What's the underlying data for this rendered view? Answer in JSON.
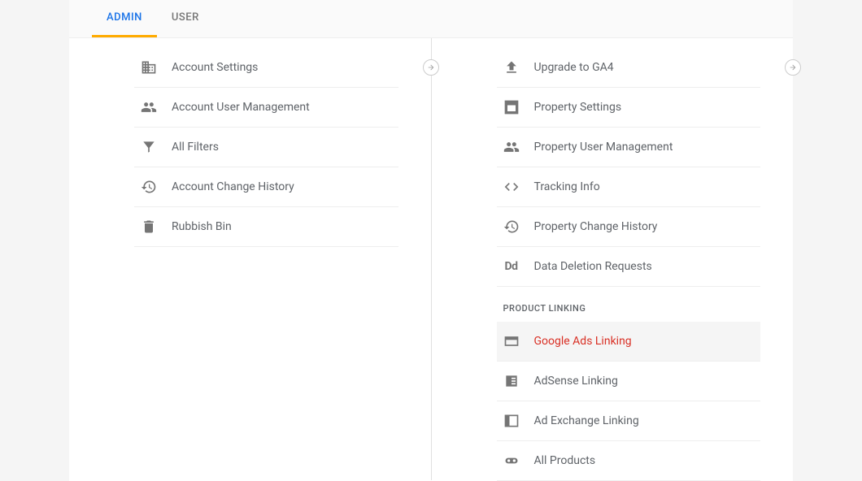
{
  "tabs": {
    "admin": "ADMIN",
    "user": "USER"
  },
  "account": {
    "settings": "Account Settings",
    "userMgmt": "Account User Management",
    "filters": "All Filters",
    "history": "Account Change History",
    "rubbish": "Rubbish Bin"
  },
  "property": {
    "upgrade": "Upgrade to GA4",
    "settings": "Property Settings",
    "userMgmt": "Property User Management",
    "tracking": "Tracking Info",
    "history": "Property Change History",
    "deletion": "Data Deletion Requests",
    "sectionHeader": "PRODUCT LINKING",
    "adsLinking": "Google Ads Linking",
    "adsense": "AdSense Linking",
    "adExchange": "Ad Exchange Linking",
    "allProducts": "All Products"
  }
}
